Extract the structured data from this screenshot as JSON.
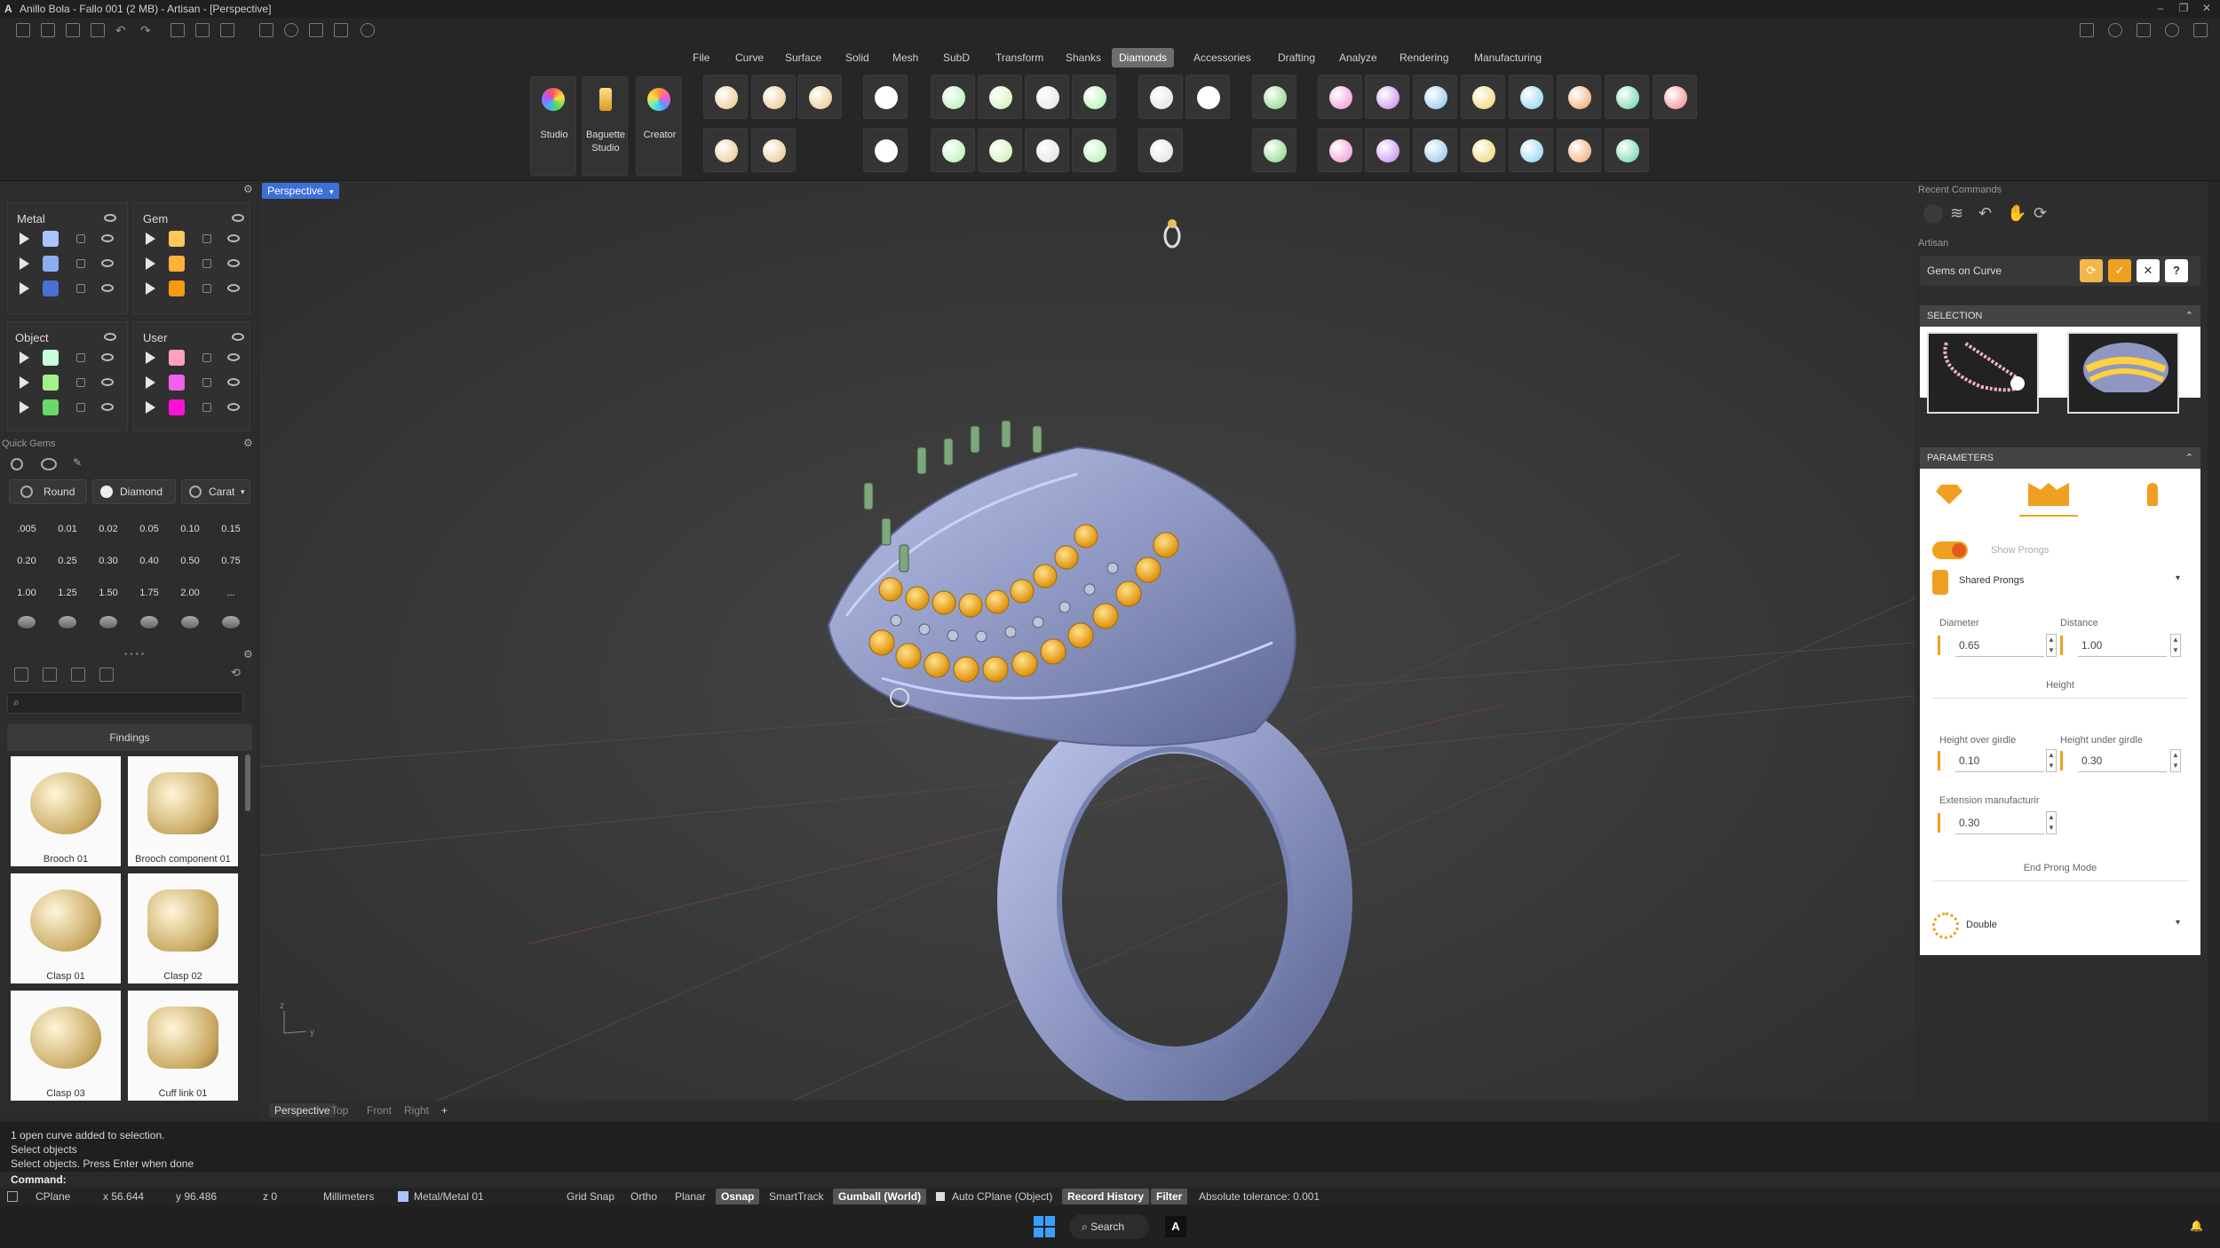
{
  "window": {
    "title": "Anillo Bola - Fallo 001 (2 MB) - Artisan - [Perspective]",
    "logo": "A"
  },
  "menu": {
    "tabs": [
      "File",
      "Curve",
      "Surface",
      "Solid",
      "Mesh",
      "SubD",
      "Transform",
      "Shanks",
      "Diamonds",
      "Accessories",
      "Drafting",
      "Analyze",
      "Rendering",
      "Manufacturing"
    ],
    "active": "Diamonds"
  },
  "ribbon": {
    "studio_label": "Studio",
    "baguette_label": "Baguette Studio",
    "creator_label": "Creator"
  },
  "layers": {
    "metal_title": "Metal",
    "gem_title": "Gem",
    "object_title": "Object",
    "user_title": "User",
    "metal_colors": [
      "#a9c4ff",
      "#8aaef0",
      "#4a6fd6"
    ],
    "gem_colors": [
      "#ffc85a",
      "#ffb13a",
      "#f59b12"
    ],
    "object_colors": [
      "#c8ffd8",
      "#a6f08a",
      "#6ad86a"
    ],
    "user_colors": [
      "#ff9fc4",
      "#f060e8",
      "#ff10d8"
    ]
  },
  "quick_gems": {
    "title": "Quick Gems",
    "shape": "Round",
    "material": "Diamond",
    "unit": "Carat",
    "values": [
      ".005",
      "0.01",
      "0.02",
      "0.05",
      "0.10",
      "0.15",
      "0.20",
      "0.25",
      "0.30",
      "0.40",
      "0.50",
      "0.75",
      "1.00",
      "1.25",
      "1.50",
      "1.75",
      "2.00",
      "..."
    ]
  },
  "library": {
    "category": "Findings",
    "items": [
      "Brooch 01",
      "Brooch component 01",
      "Clasp 01",
      "Clasp 02",
      "Clasp 03",
      "Cuff link 01"
    ]
  },
  "viewport": {
    "name": "Perspective",
    "tabs": [
      "Perspective",
      "Top",
      "Front",
      "Right"
    ],
    "add": "+"
  },
  "right_panel": {
    "recent_title": "Recent Commands",
    "artisan_title": "Artisan",
    "command": "Gems on Curve",
    "selection_title": "SELECTION",
    "parameters_title": "PARAMETERS",
    "show_prongs": "Show Prongs",
    "prong_type": "Shared Prongs",
    "diameter_label": "Diameter",
    "diameter": "0.65",
    "distance_label": "Distance",
    "distance": "1.00",
    "height_title": "Height",
    "height_over_label": "Height over girdle",
    "height_over": "0.10",
    "height_under_label": "Height under girdle",
    "height_under": "0.30",
    "extension_label": "Extension manufacturir",
    "extension": "0.30",
    "end_mode_title": "End Prong Mode",
    "end_mode": "Double",
    "help": "?"
  },
  "command_history": [
    "1 open curve added to selection.",
    "Select objects",
    "Select objects. Press Enter when done"
  ],
  "command_prompt": "Command:",
  "status": {
    "cplane": "CPlane",
    "x": "x 56.644",
    "y": "y 96.486",
    "z": "z 0",
    "units": "Millimeters",
    "layer": "Metal/Metal 01",
    "grid_snap": "Grid Snap",
    "ortho": "Ortho",
    "planar": "Planar",
    "osnap": "Osnap",
    "smarttrack": "SmartTrack",
    "gumball": "Gumball (World)",
    "auto_cplane": "Auto CPlane (Object)",
    "record_history": "Record History",
    "filter": "Filter",
    "tolerance": "Absolute tolerance: 0.001"
  },
  "taskbar": {
    "search": "Search"
  }
}
